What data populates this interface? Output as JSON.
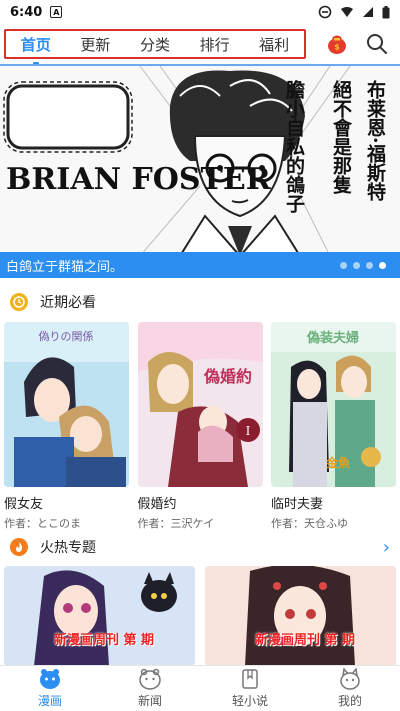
{
  "status": {
    "time": "6:40",
    "notif": "A"
  },
  "nav": {
    "tabs": [
      "首页",
      "更新",
      "分类",
      "排行",
      "福利"
    ],
    "active_index": 0,
    "icons": [
      "red-envelope-icon",
      "search-icon"
    ]
  },
  "banner": {
    "brand": "BRIAN FOSTER",
    "vertical_text_1": "布莱恩·福斯特",
    "vertical_text_2": "絕不會是那隻",
    "vertical_text_3": "膽小自私的鴿子",
    "caption": "白鸽立于群猫之间。",
    "slide_count": 4,
    "active_slide": 3
  },
  "recent": {
    "title": "近期必看",
    "items": [
      {
        "title": "假女友",
        "author": "作者：とこのま"
      },
      {
        "title": "假婚约",
        "author": "作者：三沢ケイ"
      },
      {
        "title": "临时夫妻",
        "author": "作者：天仓ふゆ"
      }
    ]
  },
  "hot": {
    "title": "火热专题",
    "items": [
      {
        "badge": "新漫画周刊 第 期"
      },
      {
        "badge": "新漫画周刊 第 期"
      }
    ]
  },
  "bottom": {
    "items": [
      {
        "label": "漫画",
        "icon": "comic-icon"
      },
      {
        "label": "新闻",
        "icon": "news-icon"
      },
      {
        "label": "轻小说",
        "icon": "novel-icon"
      },
      {
        "label": "我的",
        "icon": "profile-icon"
      }
    ],
    "active_index": 0
  },
  "colors": {
    "accent": "#2b8ef0",
    "highlight_box": "#d9302c"
  }
}
